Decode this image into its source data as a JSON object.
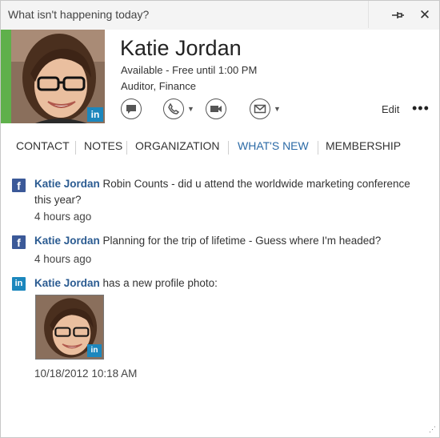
{
  "titlebar": {
    "status_text": "What isn't happening today?",
    "pin_icon": "pin-icon",
    "close_label": "✕"
  },
  "contact": {
    "name": "Katie Jordan",
    "availability": "Available - Free until 1:00 PM",
    "job_title": "Auditor, Finance",
    "presence_color": "#5fb04b",
    "badge_text": "in",
    "edit_label": "Edit",
    "more_label": "•••",
    "action_icons": [
      "chat-icon",
      "phone-icon",
      "video-icon",
      "email-icon"
    ]
  },
  "tabs": [
    {
      "label": "CONTACT"
    },
    {
      "label": "NOTES"
    },
    {
      "label": "ORGANIZATION"
    },
    {
      "label": "WHAT'S NEW"
    },
    {
      "label": "MEMBERSHIP"
    }
  ],
  "feed": [
    {
      "source": "facebook",
      "author": "Katie Jordan",
      "text": "Robin Counts - did u attend the worldwide marketing conference this year?",
      "time": "4 hours ago"
    },
    {
      "source": "facebook",
      "author": "Katie Jordan",
      "text": "Planning for the trip of lifetime - Guess where I'm headed?",
      "time": "4 hours ago"
    },
    {
      "source": "linkedin",
      "author": "Katie Jordan",
      "text": "has a new profile photo:",
      "time": "10/18/2012 10:18 AM"
    }
  ],
  "colors": {
    "accent_link": "#2b5b91",
    "active_tab": "#2b6aa6",
    "facebook": "#3b5998",
    "linkedin": "#1c87bd"
  }
}
